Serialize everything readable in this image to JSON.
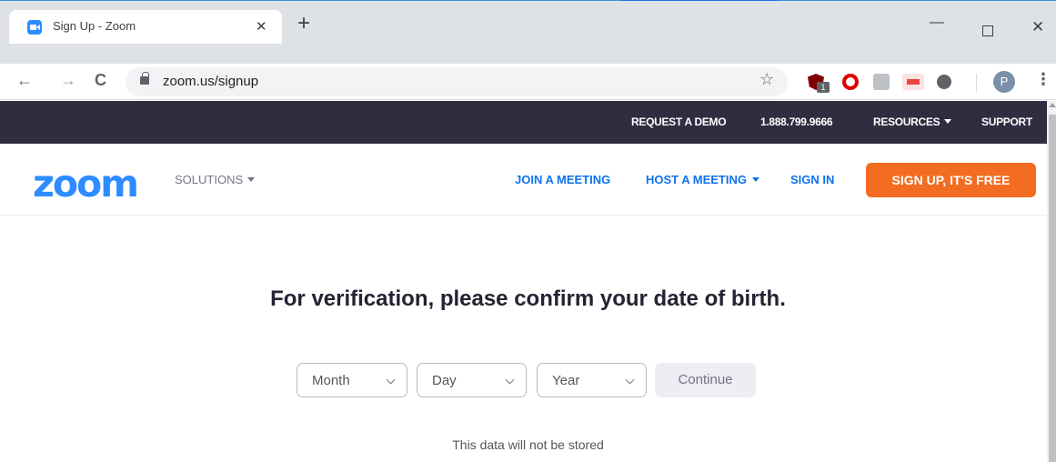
{
  "browser": {
    "tab_title": "Sign Up - Zoom",
    "tab_close": "✕",
    "new_tab": "+",
    "window": {
      "minimize": "—",
      "close": "✕"
    },
    "nav": {
      "back": "←",
      "forward": "→",
      "reload": "C"
    },
    "url": "zoom.us/signup",
    "star": "☆",
    "ext_badge": "1",
    "avatar_initial": "P",
    "menu": "⋮"
  },
  "topbar": {
    "request_demo": "REQUEST A DEMO",
    "phone": "1.888.799.9666",
    "resources": "RESOURCES",
    "support": "SUPPORT"
  },
  "mainnav": {
    "logo": "zoom",
    "solutions": "SOLUTIONS",
    "join_meeting": "JOIN A MEETING",
    "host_meeting": "HOST A MEETING",
    "sign_in": "SIGN IN",
    "sign_up": "SIGN UP, IT'S FREE"
  },
  "main": {
    "heading": "For verification, please confirm your date of birth.",
    "month_label": "Month",
    "day_label": "Day",
    "year_label": "Year",
    "continue_label": "Continue",
    "note": "This data will not be stored"
  },
  "colors": {
    "accent": "#2d8cff",
    "link": "#0e72ed",
    "cta": "#f26d21",
    "topbar": "#2f2e41"
  }
}
